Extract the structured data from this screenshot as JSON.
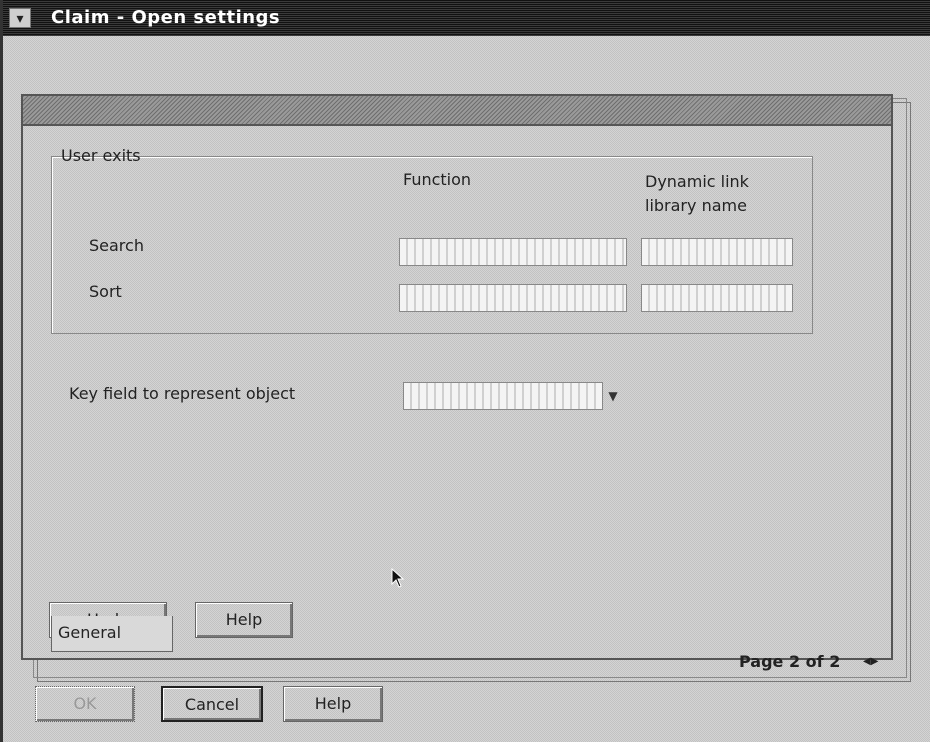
{
  "window": {
    "title": "Claim - Open settings",
    "system_menu_icon": "down-arrow-icon"
  },
  "notebook": {
    "group": {
      "title": "User exits",
      "col_function": "Function",
      "col_dll_line1": "Dynamic link",
      "col_dll_line2": "library name",
      "rows": [
        {
          "label": "Search",
          "function": "",
          "dll": ""
        },
        {
          "label": "Sort",
          "function": "",
          "dll": ""
        }
      ]
    },
    "key_field_label": "Key field to represent object",
    "key_field_value": "",
    "undo_label": "Undo",
    "help_label": "Help",
    "page_indicator": "Page 2 of 2",
    "tab_general": "General"
  },
  "buttons": {
    "ok": "OK",
    "cancel": "Cancel",
    "help": "Help"
  }
}
